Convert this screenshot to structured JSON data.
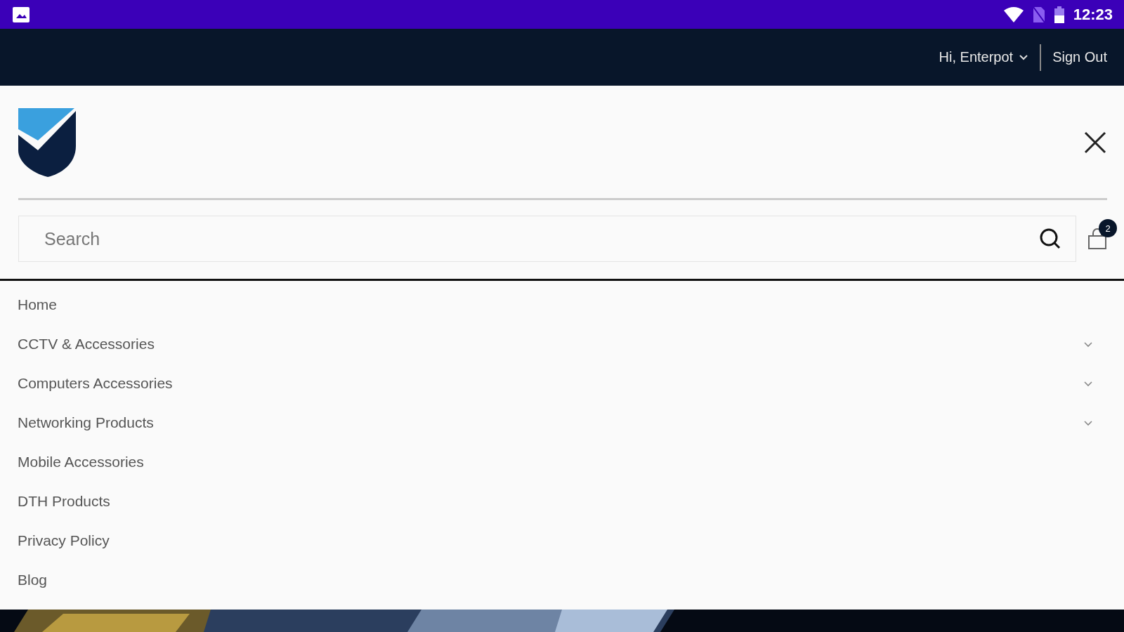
{
  "status_bar": {
    "time": "12:23"
  },
  "top_bar": {
    "greeting": "Hi, Enterpot",
    "sign_out": "Sign Out"
  },
  "search": {
    "placeholder": "Search"
  },
  "cart": {
    "count": "2"
  },
  "menu": [
    {
      "label": "Home",
      "expandable": false
    },
    {
      "label": "CCTV & Accessories",
      "expandable": true
    },
    {
      "label": "Computers Accessories",
      "expandable": true
    },
    {
      "label": "Networking Products",
      "expandable": true
    },
    {
      "label": "Mobile Accessories",
      "expandable": false
    },
    {
      "label": "DTH Products",
      "expandable": false
    },
    {
      "label": "Privacy Policy",
      "expandable": false
    },
    {
      "label": "Blog",
      "expandable": false
    }
  ]
}
